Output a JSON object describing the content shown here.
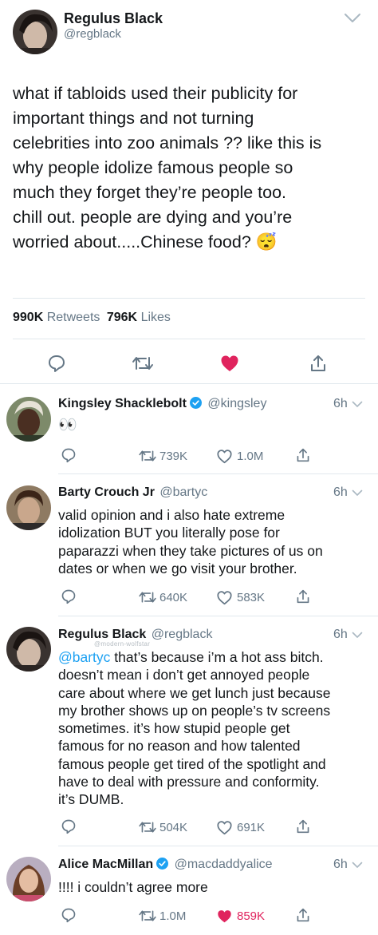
{
  "main_tweet": {
    "name": "Regulus Black",
    "handle": "@regblack",
    "text_lines": [
      "what if tabloids used their publicity for",
      "important things and not turning",
      "celebrities into zoo animals ?? like this is",
      "why people idolize famous people so",
      "much they forget they’re people too.",
      "chill out. people are dying and you’re",
      "worried about.....Chinese food? 😴"
    ],
    "retweets_count": "990K",
    "retweets_label": "Retweets",
    "likes_count": "796K",
    "likes_label": "Likes",
    "liked": true
  },
  "replies": [
    {
      "name": "Kingsley Shacklebolt",
      "verified": true,
      "handle": "@kingsley",
      "time": "6h",
      "text": "👀",
      "retweets": "739K",
      "likes": "1.0M",
      "liked": false
    },
    {
      "name": "Barty Crouch Jr",
      "verified": false,
      "handle": "@bartyc",
      "time": "6h",
      "text_lines": [
        "valid opinion and i also hate extreme",
        "idolization BUT you literally pose for",
        "paparazzi when they take pictures of us on",
        "dates or when we go visit your brother."
      ],
      "retweets": "640K",
      "likes": "583K",
      "liked": false
    },
    {
      "name": "Regulus Black",
      "verified": false,
      "handle": "@regblack",
      "time": "6h",
      "watermark": "@modern-wolfstar",
      "mention": "@bartyc",
      "first_line_rest": " that’s because i’m a hot ass bitch.",
      "text_lines": [
        "doesn’t mean i don’t get annoyed people",
        "care about where we get lunch just because",
        "my brother shows up on people’s tv screens",
        "sometimes. it’s how stupid people get",
        "famous for no reason and how talented",
        "famous people get tired of the spotlight and",
        "have to deal with pressure and conformity.",
        "it’s DUMB."
      ],
      "retweets": "504K",
      "likes": "691K",
      "liked": false
    },
    {
      "name": "Alice MacMillan",
      "verified": true,
      "handle": "@macdaddyalice",
      "time": "6h",
      "text": "!!!! i couldn’t agree more",
      "retweets": "1.0M",
      "likes": "859K",
      "liked": true
    }
  ],
  "colors": {
    "like_red": "#e0245e",
    "mention_blue": "#1da1f2",
    "verified_blue": "#1da1f2",
    "muted_gray": "#657786",
    "divider": "#e1e8ed"
  }
}
